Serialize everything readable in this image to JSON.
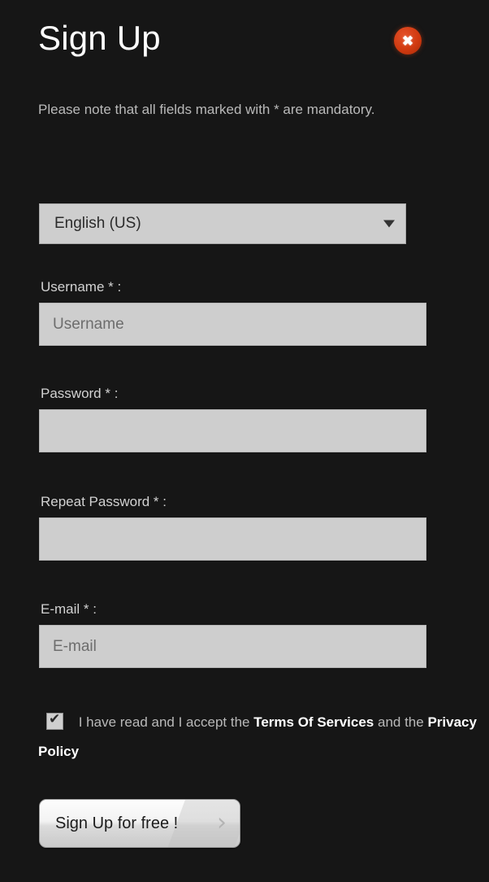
{
  "header": {
    "title": "Sign Up",
    "close_label": "✖"
  },
  "notice": {
    "text": "Please note that all fields marked with * are mandatory."
  },
  "language": {
    "selected": "English (US)",
    "options": [
      "English (US)"
    ]
  },
  "fields": [
    {
      "id": "username",
      "label": "Username * :",
      "placeholder": "Username",
      "value": "",
      "type": "text"
    },
    {
      "id": "password",
      "label": "Password * :",
      "placeholder": "",
      "value": "",
      "type": "password"
    },
    {
      "id": "repeat",
      "label": "Repeat Password * :",
      "placeholder": "",
      "value": "",
      "type": "password"
    },
    {
      "id": "email",
      "label": "E-mail * :",
      "placeholder": "E-mail",
      "value": "",
      "type": "text"
    }
  ],
  "terms": {
    "checked": true,
    "text_before": "I have read and I accept the ",
    "terms_link": "Terms Of Services",
    "text_middle": " and the ",
    "privacy_link": "Privacy Policy"
  },
  "submit": {
    "label": "Sign Up for free !",
    "chevron": "›"
  },
  "colors": {
    "background": "#161616",
    "input_fill": "#cecece",
    "close_red": "#d13a10",
    "link_white": "#ffffff",
    "body_text": "#b9b9b9"
  }
}
